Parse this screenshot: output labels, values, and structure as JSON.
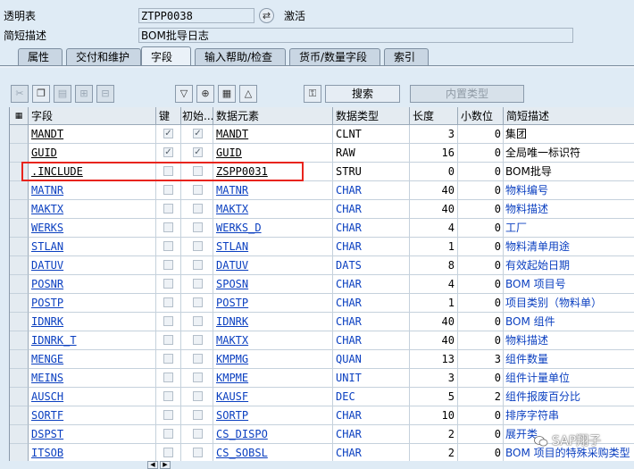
{
  "header": {
    "table_label": "透明表",
    "table_value": "ZTPP0038",
    "status": "激活",
    "desc_label": "简短描述",
    "desc_value": "BOM批导日志"
  },
  "tabs": [
    "属性",
    "交付和维护",
    "字段",
    "输入帮助/检查",
    "货币/数量字段",
    "索引"
  ],
  "active_tab": "字段",
  "toolbar": {
    "search_label": "搜索",
    "builtin_type_label": "内置类型"
  },
  "columns": [
    "字段",
    "键",
    "初始...",
    "数据元素",
    "数据类型",
    "长度",
    "小数位",
    "简短描述"
  ],
  "rows": [
    {
      "field": "MANDT",
      "key": true,
      "init": true,
      "element": "MANDT",
      "type": "CLNT",
      "len": "3",
      "dec": "0",
      "desc": "集团",
      "blue": false
    },
    {
      "field": "GUID",
      "key": true,
      "init": true,
      "element": "GUID",
      "type": "RAW",
      "len": "16",
      "dec": "0",
      "desc": "全局唯一标识符",
      "blue": false
    },
    {
      "field": ".INCLUDE",
      "key": false,
      "init": false,
      "element": "ZSPP0031",
      "type": "STRU",
      "len": "0",
      "dec": "0",
      "desc": "BOM批导",
      "blue": false
    },
    {
      "field": "MATNR",
      "key": false,
      "init": false,
      "element": "MATNR",
      "type": "CHAR",
      "len": "40",
      "dec": "0",
      "desc": "物料编号",
      "blue": true
    },
    {
      "field": "MAKTX",
      "key": false,
      "init": false,
      "element": "MAKTX",
      "type": "CHAR",
      "len": "40",
      "dec": "0",
      "desc": "物料描述",
      "blue": true
    },
    {
      "field": "WERKS",
      "key": false,
      "init": false,
      "element": "WERKS_D",
      "type": "CHAR",
      "len": "4",
      "dec": "0",
      "desc": "工厂",
      "blue": true
    },
    {
      "field": "STLAN",
      "key": false,
      "init": false,
      "element": "STLAN",
      "type": "CHAR",
      "len": "1",
      "dec": "0",
      "desc": "物料清单用途",
      "blue": true
    },
    {
      "field": "DATUV",
      "key": false,
      "init": false,
      "element": "DATUV",
      "type": "DATS",
      "len": "8",
      "dec": "0",
      "desc": "有效起始日期",
      "blue": true
    },
    {
      "field": "POSNR",
      "key": false,
      "init": false,
      "element": "SPOSN",
      "type": "CHAR",
      "len": "4",
      "dec": "0",
      "desc": "BOM 项目号",
      "blue": true
    },
    {
      "field": "POSTP",
      "key": false,
      "init": false,
      "element": "POSTP",
      "type": "CHAR",
      "len": "1",
      "dec": "0",
      "desc": "项目类别（物料单）",
      "blue": true
    },
    {
      "field": "IDNRK",
      "key": false,
      "init": false,
      "element": "IDNRK",
      "type": "CHAR",
      "len": "40",
      "dec": "0",
      "desc": "BOM 组件",
      "blue": true
    },
    {
      "field": "IDNRK_T",
      "key": false,
      "init": false,
      "element": "MAKTX",
      "type": "CHAR",
      "len": "40",
      "dec": "0",
      "desc": "物料描述",
      "blue": true
    },
    {
      "field": "MENGE",
      "key": false,
      "init": false,
      "element": "KMPMG",
      "type": "QUAN",
      "len": "13",
      "dec": "3",
      "desc": "组件数量",
      "blue": true
    },
    {
      "field": "MEINS",
      "key": false,
      "init": false,
      "element": "KMPME",
      "type": "UNIT",
      "len": "3",
      "dec": "0",
      "desc": "组件计量单位",
      "blue": true
    },
    {
      "field": "AUSCH",
      "key": false,
      "init": false,
      "element": "KAUSF",
      "type": "DEC",
      "len": "5",
      "dec": "2",
      "desc": "组件报废百分比",
      "blue": true
    },
    {
      "field": "SORTF",
      "key": false,
      "init": false,
      "element": "SORTP",
      "type": "CHAR",
      "len": "10",
      "dec": "0",
      "desc": "排序字符串",
      "blue": true
    },
    {
      "field": "DSPST",
      "key": false,
      "init": false,
      "element": "CS_DISPO",
      "type": "CHAR",
      "len": "2",
      "dec": "0",
      "desc": "展开类",
      "blue": true
    },
    {
      "field": "ITSOB",
      "key": false,
      "init": false,
      "element": "CS_SOBSL",
      "type": "CHAR",
      "len": "2",
      "dec": "0",
      "desc": "BOM 项目的特殊采购类型",
      "blue": true
    }
  ],
  "watermark": "SAP翔子"
}
